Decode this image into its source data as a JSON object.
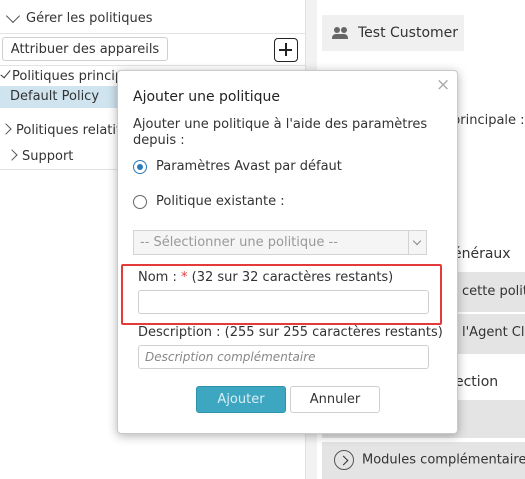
{
  "sidebar": {
    "header": "Gérer les politiques",
    "assign_button": "Attribuer des appareils",
    "tree": {
      "main_policies": "Politiques principales",
      "default_policy": "Default Policy",
      "relative_policies": "Politiques relatives",
      "support": "Support"
    }
  },
  "right_panel": {
    "customer_name": "Test Customer",
    "main_label": "principale :",
    "general_heading": "énéraux",
    "row_1": "cette polit",
    "row_2": "l'Agent Clo",
    "protection_heading": "ection",
    "modules_label": "Modules complémentaires"
  },
  "modal": {
    "close_glyph": "×",
    "title": "Ajouter une politique",
    "description": "Ajouter une politique à l'aide des paramètres depuis :",
    "option_default": "Paramètres Avast par défaut",
    "option_existing": "Politique existante :",
    "select_placeholder": "-- Sélectionner une politique --",
    "name_label": "Nom :",
    "name_required": "*",
    "name_counter": "(32 sur 32 caractères restants)",
    "name_value": "",
    "description_label": "Description : (255 sur 255 caractères restants)",
    "description_placeholder": "Description complémentaire",
    "add_button": "Ajouter",
    "cancel_button": "Annuler"
  },
  "icons": {
    "header_chevron": "chevron-down-icon",
    "add": "plus-icon",
    "customer": "people-icon",
    "close": "close-icon"
  },
  "colors": {
    "selected_row": "#cfe4ee",
    "primary_button": "#3da6c1",
    "highlight_border": "#e53a3a",
    "radio_accent": "#2b7bb9"
  }
}
